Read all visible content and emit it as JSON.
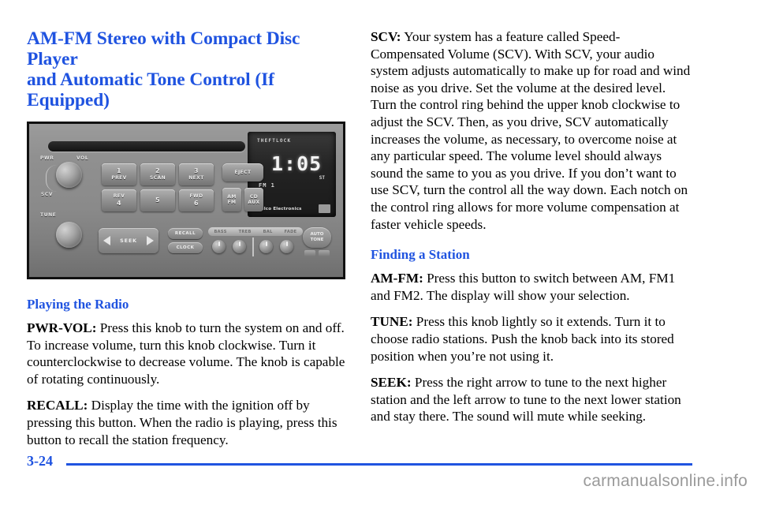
{
  "document": {
    "title_line1": "AM-FM Stereo with Compact Disc Player",
    "title_line2": "and Automatic Tone Control (If Equipped)",
    "accent_color": "#1f53e0",
    "text_color": "#000000",
    "page_number": "3-24",
    "watermark": "carmanualsonline.info"
  },
  "photo": {
    "caption": "",
    "display": {
      "theftlock": "THEFTLOCK",
      "clock": "1:05",
      "band": "FM 1",
      "stereo": "ST",
      "brand": "Delco Electronics",
      "cd_logo": "CD"
    },
    "controls": {
      "pwr_label": "PWR",
      "vol_label": "VOL",
      "scv_label": "SCV",
      "tune_label": "TUNE",
      "seek_label": "SEEK",
      "eject_label": "EJECT",
      "amfm_top": "AM",
      "amfm_bottom": "FM",
      "cdaux_top": "CD",
      "cdaux_bottom": "AUX",
      "recall_label": "RECALL",
      "clock_label": "CLOCK",
      "autotone_line1": "AUTO",
      "autotone_line2": "TONE",
      "presets": [
        {
          "num": "1",
          "sub": "PREV"
        },
        {
          "num": "2",
          "sub": "SCAN"
        },
        {
          "num": "3",
          "sub": "NEXT"
        },
        {
          "num": "4",
          "sub": "REV"
        },
        {
          "num": "5",
          "sub": ""
        },
        {
          "num": "6",
          "sub": "FWD"
        }
      ],
      "tone_strip": [
        "BASS",
        "TREB",
        "BAL",
        "FADE"
      ]
    }
  },
  "left_column": {
    "heading": "Playing the Radio",
    "paragraphs": [
      {
        "lead": "PWR-VOL:",
        "text": " Press this knob to turn the system on and off. To increase volume, turn this knob clockwise. Turn it counterclockwise to decrease volume. The knob is capable of rotating continuously."
      },
      {
        "lead": "RECALL:",
        "text": " Display the time with the ignition off by pressing this button. When the radio is playing, press this button to recall the station frequency."
      }
    ]
  },
  "right_column": {
    "intro_paragraph": {
      "lead": "SCV:",
      "text": " Your system has a feature called Speed-Compensated Volume (SCV). With SCV, your audio system adjusts automatically to make up for road and wind noise as you drive. Set the volume at the desired level. Turn the control ring behind the upper knob clockwise to adjust the SCV. Then, as you drive, SCV automatically increases the volume, as necessary, to overcome noise at any particular speed. The volume level should always sound the same to you as you drive. If you don’t want to use SCV, turn the control all the way down. Each notch on the control ring allows for more volume compensation at faster vehicle speeds."
    },
    "heading": "Finding a Station",
    "paragraphs": [
      {
        "lead": "AM-FM:",
        "text": " Press this button to switch between AM, FM1 and FM2. The display will show your selection."
      },
      {
        "lead": "TUNE:",
        "text": " Press this knob lightly so it extends. Turn it to choose radio stations. Push the knob back into its stored position when you’re not using it."
      },
      {
        "lead": "SEEK:",
        "text": " Press the right arrow to tune to the next higher station and the left arrow to tune to the next lower station and stay there. The sound will mute while seeking."
      }
    ]
  }
}
